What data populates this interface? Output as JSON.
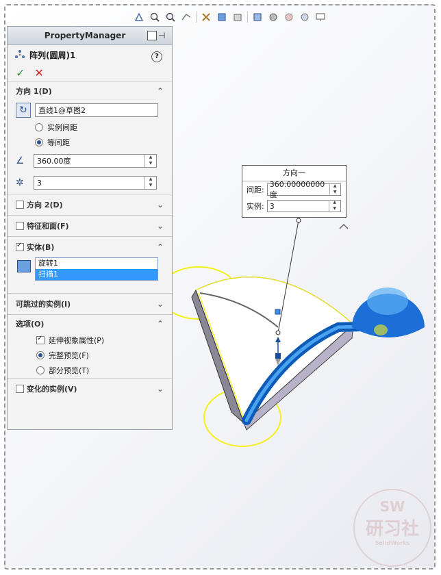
{
  "property_manager": {
    "header": "PropertyManager",
    "feature_name": "阵列(圆周)1",
    "direction1": {
      "title": "方向 1(D)",
      "axis": "直线1@草图2",
      "radio_instance_spacing": "实例间距",
      "radio_equal_spacing": "等间距",
      "angle": "360.00度",
      "count": "3"
    },
    "direction2": {
      "title": "方向 2(D)"
    },
    "features_faces": {
      "title": "特征和面(F)"
    },
    "bodies": {
      "title": "实体(B)",
      "items": [
        "旋转1",
        "扫描1"
      ]
    },
    "skip_instances": {
      "title": "可跳过的实例(I)"
    },
    "options": {
      "title": "选项(O)",
      "propagate_visual": "延伸视象属性(P)",
      "full_preview": "完整预览(F)",
      "partial_preview": "部分预览(T)"
    },
    "vary_instances": {
      "title": "变化的实例(V)"
    }
  },
  "callout": {
    "title": "方向一",
    "spacing_label": "间距:",
    "spacing_value": "360.00000000度",
    "instances_label": "实例:",
    "instances_value": "3"
  },
  "watermark": {
    "line1": "SW",
    "line2": "研习社",
    "line3": "SolidWorks"
  },
  "colors": {
    "accent_blue": "#1c6fd6",
    "highlight": "#3399ff",
    "yellow": "#f5f01a",
    "annotation_red": "#e01010"
  }
}
